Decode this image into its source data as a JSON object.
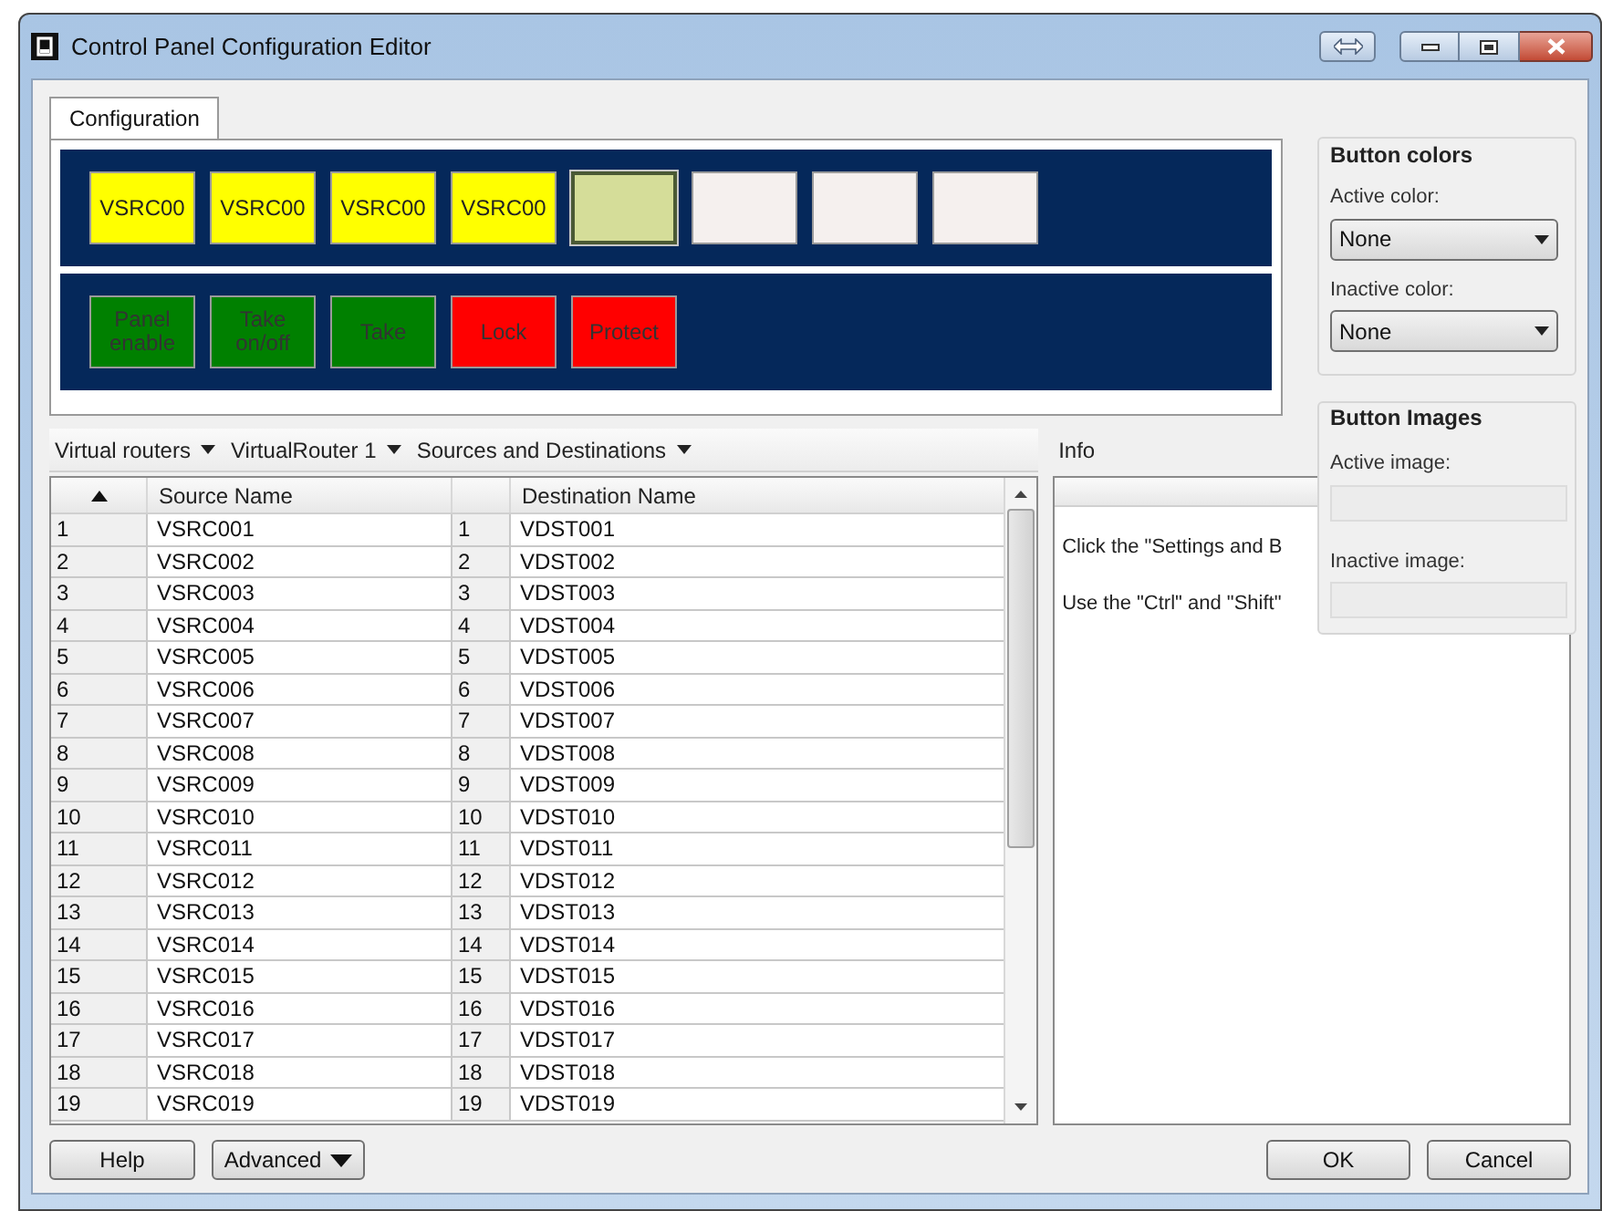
{
  "window": {
    "title": "Control Panel Configuration Editor"
  },
  "tabs": [
    {
      "label": "Configuration",
      "selected": true
    }
  ],
  "panel_rows": [
    {
      "buttons": [
        {
          "label": "VSRC00",
          "color": "#ffff00",
          "selected": false
        },
        {
          "label": "VSRC00",
          "color": "#ffff00",
          "selected": false
        },
        {
          "label": "VSRC00",
          "color": "#ffff00",
          "selected": false
        },
        {
          "label": "VSRC00",
          "color": "#ffff00",
          "selected": false
        },
        {
          "color": "#d5dd99",
          "selected": true
        },
        {
          "color": "#f5f0ee",
          "selected": false
        },
        {
          "color": "#f5f0ee",
          "selected": false
        },
        {
          "color": "#f5f0ee",
          "selected": false
        }
      ]
    },
    {
      "buttons": [
        {
          "label": "Panel enable",
          "color": "#008000",
          "selected": false
        },
        {
          "label": "Take on/off",
          "color": "#008000",
          "selected": false
        },
        {
          "label": "Take",
          "color": "#008000",
          "selected": false
        },
        {
          "label": "Lock",
          "color": "#ff0000",
          "selected": false
        },
        {
          "label": "Protect",
          "color": "#ff0000",
          "selected": false
        }
      ]
    }
  ],
  "button_colors": {
    "title": "Button colors",
    "active_label": "Active color:",
    "active_value": "None",
    "inactive_label": "Inactive color:",
    "inactive_value": "None"
  },
  "button_images": {
    "title": "Button Images",
    "active_label": "Active image:",
    "inactive_label": "Inactive image:"
  },
  "breadcrumbs": [
    "Virtual routers",
    "VirtualRouter 1",
    "Sources and Destinations"
  ],
  "table": {
    "columns": [
      "",
      "Source Name",
      "",
      "Destination Name"
    ],
    "rows": [
      [
        "1",
        "VSRC001",
        "1",
        "VDST001"
      ],
      [
        "2",
        "VSRC002",
        "2",
        "VDST002"
      ],
      [
        "3",
        "VSRC003",
        "3",
        "VDST003"
      ],
      [
        "4",
        "VSRC004",
        "4",
        "VDST004"
      ],
      [
        "5",
        "VSRC005",
        "5",
        "VDST005"
      ],
      [
        "6",
        "VSRC006",
        "6",
        "VDST006"
      ],
      [
        "7",
        "VSRC007",
        "7",
        "VDST007"
      ],
      [
        "8",
        "VSRC008",
        "8",
        "VDST008"
      ],
      [
        "9",
        "VSRC009",
        "9",
        "VDST009"
      ],
      [
        "10",
        "VSRC010",
        "10",
        "VDST010"
      ],
      [
        "11",
        "VSRC011",
        "11",
        "VDST011"
      ],
      [
        "12",
        "VSRC012",
        "12",
        "VDST012"
      ],
      [
        "13",
        "VSRC013",
        "13",
        "VDST013"
      ],
      [
        "14",
        "VSRC014",
        "14",
        "VDST014"
      ],
      [
        "15",
        "VSRC015",
        "15",
        "VDST015"
      ],
      [
        "16",
        "VSRC016",
        "16",
        "VDST016"
      ],
      [
        "17",
        "VSRC017",
        "17",
        "VDST017"
      ],
      [
        "18",
        "VSRC018",
        "18",
        "VDST018"
      ],
      [
        "19",
        "VSRC019",
        "19",
        "VDST019"
      ]
    ]
  },
  "info": {
    "title": "Info",
    "lines": [
      "Click the \"Settings and B",
      "Use the \"Ctrl\" and \"Shift\""
    ]
  },
  "footer": {
    "left": [
      "Help",
      "Advanced"
    ],
    "right": [
      "OK",
      "Cancel"
    ]
  }
}
